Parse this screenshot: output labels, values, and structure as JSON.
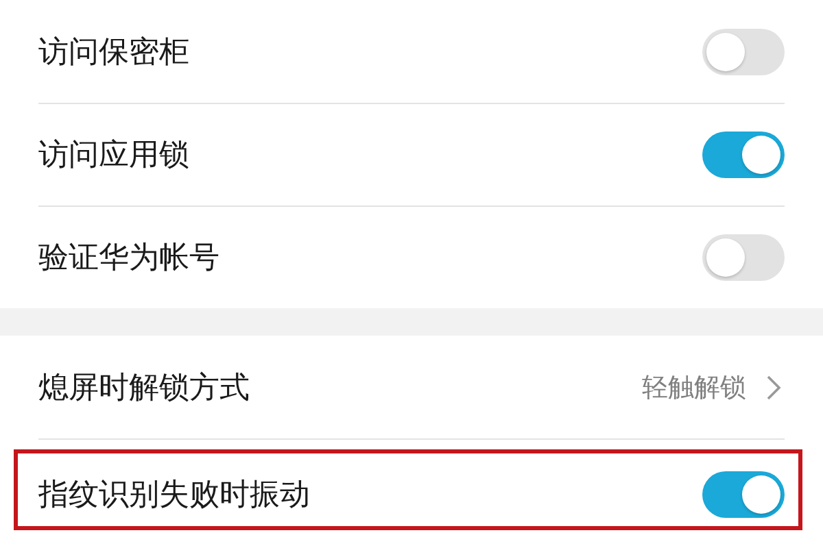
{
  "sections": [
    {
      "items": [
        {
          "kind": "toggle",
          "label": "访问保密柜",
          "on": false,
          "highlighted": false
        },
        {
          "kind": "toggle",
          "label": "访问应用锁",
          "on": true,
          "highlighted": false
        },
        {
          "kind": "toggle",
          "label": "验证华为帐号",
          "on": false,
          "highlighted": false
        }
      ]
    },
    {
      "items": [
        {
          "kind": "link",
          "label": "熄屏时解锁方式",
          "value": "轻触解锁",
          "highlighted": false
        },
        {
          "kind": "toggle",
          "label": "指纹识别失败时振动",
          "on": true,
          "highlighted": true
        }
      ]
    }
  ]
}
